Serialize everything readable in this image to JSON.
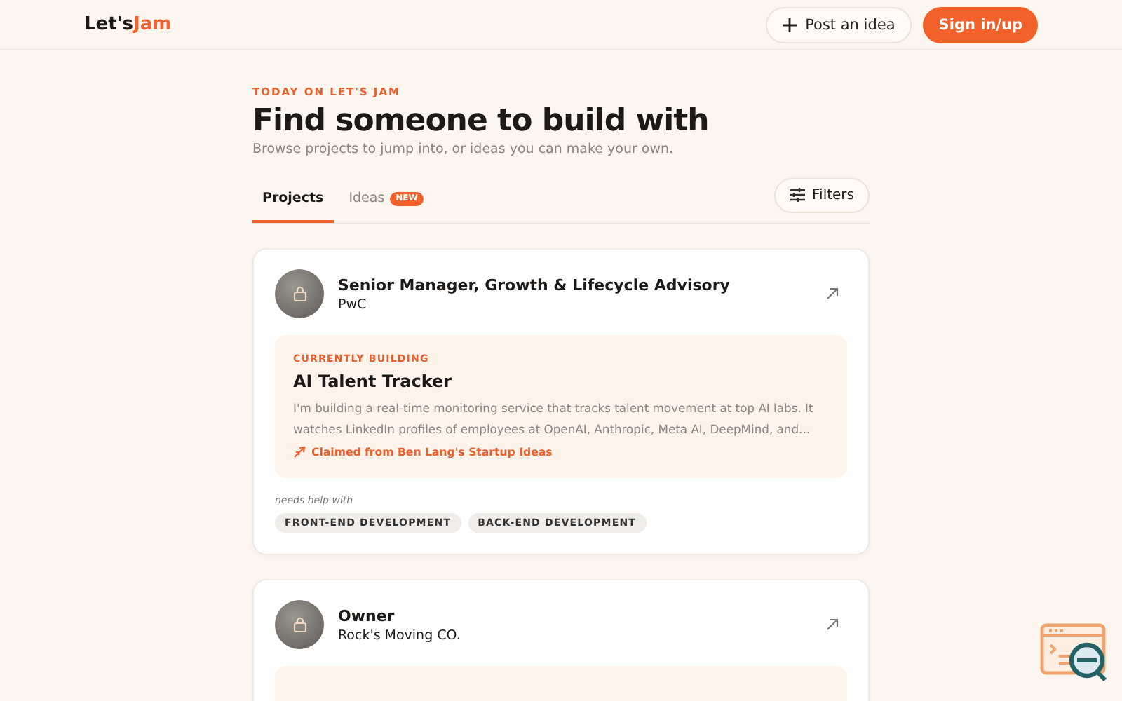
{
  "header": {
    "logo_prefix": "Let's",
    "logo_accent": "Jam",
    "post_button": "Post an idea",
    "sign_in_button": "Sign in/up"
  },
  "intro": {
    "eyebrow": "TODAY ON LET'S JAM",
    "title": "Find someone to build with",
    "subtitle": "Browse projects to jump into, or ideas you can make your own."
  },
  "tabs": [
    {
      "label": "Projects",
      "selected": true
    },
    {
      "label": "Ideas",
      "selected": false,
      "badge": "NEW"
    }
  ],
  "filters_button": "Filters",
  "cards": [
    {
      "title": "Senior Manager, Growth & Lifecycle Advisory",
      "company": "PwC",
      "building": {
        "label": "CURRENTLY BUILDING",
        "name": "AI Talent Tracker",
        "description": "I'm building a real-time monitoring service that tracks talent movement at top AI labs. It watches LinkedIn profiles of employees at OpenAI, Anthropic, Meta AI, DeepMind, and...",
        "source": "Claimed from Ben Lang's Startup Ideas"
      },
      "needs_label": "needs help with",
      "tags": [
        "FRONT-END DEVELOPMENT",
        "BACK-END DEVELOPMENT"
      ]
    },
    {
      "title": "Owner",
      "company": "Rock's Moving CO."
    }
  ]
}
